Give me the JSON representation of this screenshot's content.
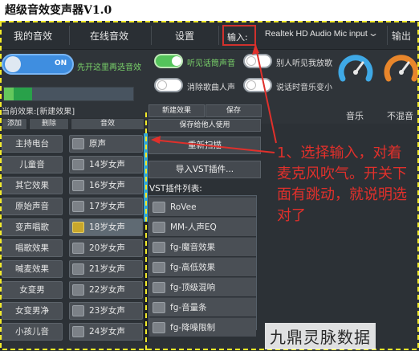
{
  "window": {
    "title": "超级音效变声器V1.0"
  },
  "tabs": [
    "我的音效",
    "在线音效",
    "设置"
  ],
  "input": {
    "label": "输入:",
    "device": "Realtek HD Audio Mic input",
    "output_label": "输出"
  },
  "controls": {
    "master_toggle_text": "ON",
    "master_hint": "先开这里再选音效",
    "toggles": [
      {
        "label": "听见话筒声音",
        "state": "on"
      },
      {
        "label": "别人听见我放歌",
        "state": "off"
      },
      {
        "label": "消除歌曲人声",
        "state": "off"
      },
      {
        "label": "说话时音乐变小",
        "state": "off"
      }
    ],
    "gauges": [
      {
        "label": "音乐",
        "color": "#3fa9e6"
      },
      {
        "label": "不混音",
        "color": "#e8862b"
      }
    ],
    "meter_level": 0.22
  },
  "left": {
    "header": "当前效果:[新建效果]",
    "toolbar": [
      "添加",
      "删除",
      "音效"
    ],
    "categories": [
      "主持电台",
      "儿童音",
      "其它效果",
      "原始声音",
      "变声唱歌",
      "唱歌效果",
      "喊麦效果",
      "女变男",
      "女变男净",
      "小孩儿音"
    ],
    "voices": [
      "原声",
      "14岁女声",
      "16岁女声",
      "17岁女声",
      "18岁女声",
      "20岁女声",
      "21岁女声",
      "22岁女声",
      "23岁女声",
      "24岁女声"
    ],
    "selected_voice_index": 4
  },
  "right": {
    "top_buttons": [
      "新建效果",
      "保存"
    ],
    "save_for_others": "保存给他人使用",
    "rescan": "重新扫描",
    "import_vst": "导入VST插件...",
    "vst_list_label": "VST插件列表:",
    "vst_items": [
      "RoVee",
      "MM-人声EQ",
      "fg-魔音效果",
      "fg-高低效果",
      "fg-顶级混响",
      "fg-音量条",
      "fg-降噪限制"
    ]
  },
  "annotation": {
    "text": "1、选择输入，对着麦克风吹气。开关下面有跳动，就说明选对了",
    "color": "#e0302b"
  },
  "watermark": "九鼎灵脉数据"
}
